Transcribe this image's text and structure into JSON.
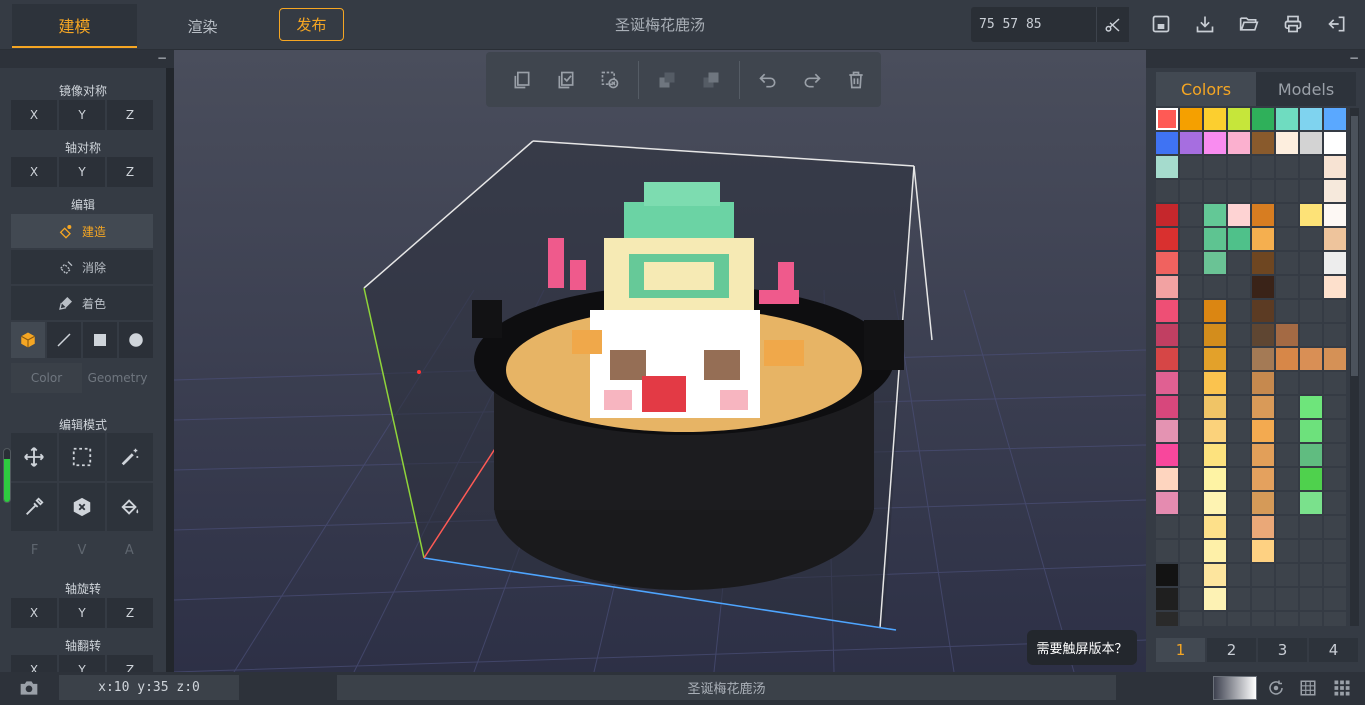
{
  "header": {
    "tab_model": "建模",
    "tab_render": "渲染",
    "publish_label": "发布",
    "title": "圣诞梅花鹿汤",
    "size_value": "75  57  85"
  },
  "left_panel": {
    "mirror_label": "镜像对称",
    "mirror_axes": [
      "X",
      "Y",
      "Z"
    ],
    "axis_sym_label": "轴对称",
    "axis_sym_axes": [
      "X",
      "Y",
      "Z"
    ],
    "edit_label": "编辑",
    "edit_build": "建造",
    "edit_erase": "消除",
    "edit_paint": "着色",
    "color_tab": "Color",
    "geometry_tab": "Geometry",
    "edit_mode_label": "编辑模式",
    "fva": [
      "F",
      "V",
      "A"
    ],
    "rotate_label": "轴旋转",
    "rotate_axes": [
      "X",
      "Y",
      "Z"
    ],
    "flip_label": "轴翻转",
    "flip_axes": [
      "X",
      "Y",
      "Z"
    ],
    "level_fraction": 0.82
  },
  "right_panel": {
    "tab_colors": "Colors",
    "tab_models": "Models",
    "pages": [
      "1",
      "2",
      "3",
      "4"
    ],
    "active_page": "1",
    "palette": [
      "#ff5a55",
      "#f5a000",
      "#fccf2f",
      "#c6e63a",
      "#2fb05a",
      "#6fdcc0",
      "#7fd3ef",
      "#5aa8ff",
      "#3f73f3",
      "#a66ee0",
      "#f98cf0",
      "#fbb0cf",
      "#895a2c",
      "#fdeede",
      "#d3d3d3",
      "#ffffff",
      "#a5dbcd",
      "#3d434b",
      "#3d434b",
      "#3d434b",
      "#3d434b",
      "#3d434b",
      "#3d434b",
      "#f7e3d3",
      "#3d434b",
      "#3d434b",
      "#3d434b",
      "#3d434b",
      "#3d434b",
      "#3d434b",
      "#3d434b",
      "#f6e9dc",
      "#c5272c",
      "#3d434b",
      "#63c896",
      "#fed3d3",
      "#d77d21",
      "#3d434b",
      "#fde277",
      "#fdf8f4",
      "#d9302f",
      "#3d434b",
      "#5ec491",
      "#4fc18a",
      "#f5af4f",
      "#3d434b",
      "#3d434b",
      "#eec49c",
      "#f0625f",
      "#3d434b",
      "#6ac395",
      "#3d434b",
      "#6e4621",
      "#3d434b",
      "#3d434b",
      "#ededed",
      "#f2a2a2",
      "#3d434b",
      "#3d434b",
      "#3d434b",
      "#3a2318",
      "#3d434b",
      "#3d434b",
      "#fde0cc",
      "#ee4f75",
      "#3d434b",
      "#db8612",
      "#3d434b",
      "#5c3b23",
      "#3d434b",
      "#3d434b",
      "#3d434b",
      "#c13f62",
      "#3d434b",
      "#d38d1c",
      "#3d434b",
      "#5f4632",
      "#a46a44",
      "#3d434b",
      "#3d434b",
      "#d64646",
      "#3d434b",
      "#e3a12a",
      "#3d434b",
      "#a47a55",
      "#d78748",
      "#d98f55",
      "#d59156",
      "#e06092",
      "#3d434b",
      "#fbc34e",
      "#3d434b",
      "#c6894e",
      "#3d434b",
      "#3d434b",
      "#3d434b",
      "#d7477c",
      "#3d434b",
      "#f0c466",
      "#3d434b",
      "#d99a58",
      "#3d434b",
      "#6ee57b",
      "#3d434b",
      "#e493b2",
      "#3d434b",
      "#fbd27b",
      "#3d434b",
      "#f3aa50",
      "#3d434b",
      "#6de17c",
      "#3d434b",
      "#f8479c",
      "#3d434b",
      "#fde27e",
      "#3d434b",
      "#e29f59",
      "#3d434b",
      "#60bc80",
      "#3d434b",
      "#fed5bf",
      "#3d434b",
      "#fef3a4",
      "#3d434b",
      "#e4a15e",
      "#3d434b",
      "#4fd14d",
      "#3d434b",
      "#e58bb0",
      "#3d434b",
      "#fef3b2",
      "#3d434b",
      "#d59a58",
      "#3d434b",
      "#7ae18c",
      "#3d434b",
      "#3d434b",
      "#3d434b",
      "#fde08a",
      "#3d434b",
      "#eaa878",
      "#3d434b",
      "#3d434b",
      "#3d434b",
      "#3d434b",
      "#3d434b",
      "#fef0a8",
      "#3d434b",
      "#fed182",
      "#3d434b",
      "#3d434b",
      "#3d434b",
      "#131313",
      "#3d434b",
      "#fde59e",
      "#3d434b",
      "#3d434b",
      "#3d434b",
      "#3d434b",
      "#3d434b",
      "#1f1f1f",
      "#3d434b",
      "#fdf2b4",
      "#3d434b",
      "#3d434b",
      "#3d434b",
      "#3d434b",
      "#3d434b",
      "#2a2a2a",
      "#3d434b",
      "#3d434b",
      "#3d434b",
      "#3d434b",
      "#3d434b",
      "#3d434b",
      "#3d434b"
    ]
  },
  "viewport": {
    "touch_tooltip": "需要触屏版本？"
  },
  "footer": {
    "coords": "x:10  y:35  z:0",
    "title": "圣诞梅花鹿汤"
  }
}
